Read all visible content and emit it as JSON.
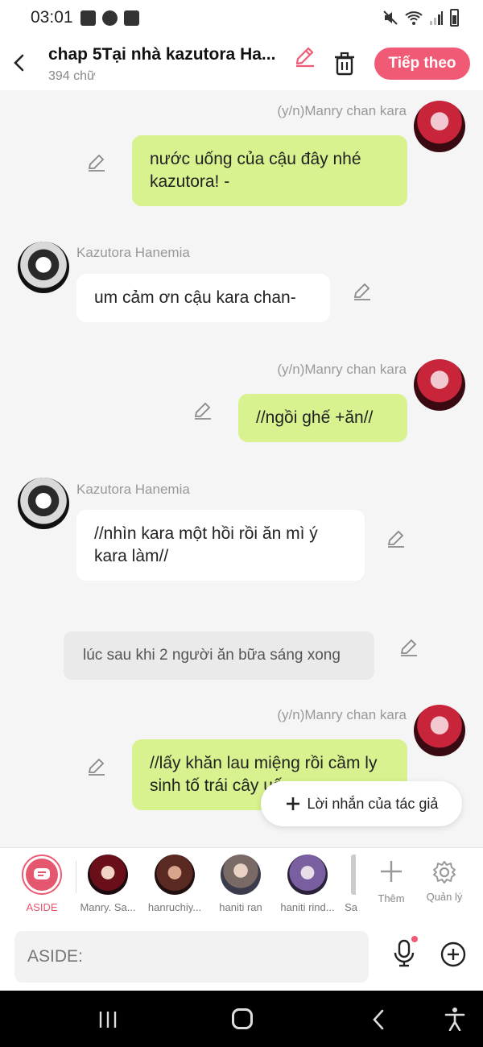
{
  "status": {
    "time": "03:01"
  },
  "header": {
    "title": "chap 5Tại nhà kazutora Ha...",
    "word_count": "394 chữ",
    "next_label": "Tiếp theo"
  },
  "messages": [
    {
      "sender": "(y/n)Manry chan kara",
      "text": "nước uống của cậu đây nhé kazutora! -"
    },
    {
      "sender": "Kazutora Hanemia",
      "text": "um cảm ơn cậu kara chan-"
    },
    {
      "sender": "(y/n)Manry chan kara",
      "text": "//ngồi ghế +ăn//"
    },
    {
      "sender": "Kazutora Hanemia",
      "text": "//nhìn kara một hồi rồi ăn mì ý kara làm//"
    },
    {
      "narration": "lúc sau khi 2 người ăn bữa sáng xong"
    },
    {
      "sender": "(y/n)Manry chan kara",
      "text": "//lấy khăn lau miệng rồi cầm ly sinh tố trái cây uống"
    }
  ],
  "author_note_label": "Lời nhắn của tác giả",
  "characters": [
    {
      "name": "ASIDE"
    },
    {
      "name": "Manry. Sa..."
    },
    {
      "name": "hanruchiy..."
    },
    {
      "name": "haniti ran"
    },
    {
      "name": "haniti rind..."
    },
    {
      "name": "Sa"
    }
  ],
  "tools": {
    "add_label": "Thêm",
    "manage_label": "Quản lý"
  },
  "input": {
    "placeholder": "ASIDE:"
  },
  "colors": {
    "accent": "#f05a75",
    "green_bubble": "#d7f28e"
  }
}
